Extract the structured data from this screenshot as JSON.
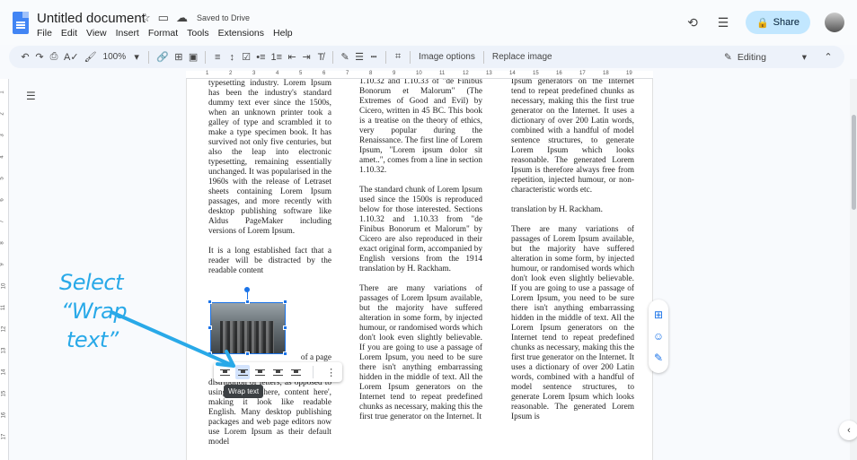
{
  "doc": {
    "title": "Untitled document",
    "saved_status": "Saved to Drive",
    "share_label": "Share"
  },
  "menu": [
    "File",
    "Edit",
    "View",
    "Insert",
    "Format",
    "Tools",
    "Extensions",
    "Help"
  ],
  "toolbar": {
    "zoom": "100%",
    "image_options_label": "Image options",
    "replace_image_label": "Replace image",
    "mode": "Editing"
  },
  "ruler_top_numbers": [
    "1",
    "2",
    "3",
    "4",
    "5",
    "6",
    "7",
    "8",
    "9",
    "10",
    "11",
    "12",
    "13",
    "14",
    "15",
    "16",
    "17",
    "18",
    "19"
  ],
  "ruler_left_numbers": [
    "1",
    "2",
    "3",
    "4",
    "5",
    "6",
    "7",
    "8",
    "9",
    "10",
    "11",
    "12",
    "13",
    "14",
    "15",
    "16",
    "17"
  ],
  "columns": {
    "c1": [
      "typesetting industry. Lorem Ipsum has been the industry's standard dummy text ever since the 1500s, when an unknown printer took a galley of type and scrambled it to make a type specimen book. It has survived not only five centuries, but also the leap into electronic typesetting, remaining essentially unchanged. It was popularised in the 1960s with the release of Letraset sheets containing Lorem Ipsum passages, and more recently with desktop publishing software like Aldus PageMaker including versions of Lorem Ipsum.",
      "It is a long established fact that a reader will be distracted by the readable content",
      "of a page",
      "distribution of letters, as opposed to using 'Content here, content here', making it look like readable English. Many desktop publishing packages and web page editors now use Lorem Ipsum as their default model"
    ],
    "c2": [
      "1.10.32 and 1.10.33 of \"de Finibus Bonorum et Malorum\" (The Extremes of Good and Evil) by Cicero, written in 45 BC. This book is a treatise on the theory of ethics, very popular during the Renaissance. The first line of Lorem Ipsum, \"Lorem ipsum dolor sit amet..\", comes from a line in section 1.10.32.",
      "The standard chunk of Lorem Ipsum used since the 1500s is reproduced below for those interested. Sections 1.10.32 and 1.10.33 from \"de Finibus Bonorum et Malorum\" by Cicero are also reproduced in their exact original form, accompanied by English versions from the 1914 translation by H. Rackham.",
      "There are many variations of passages of Lorem Ipsum available, but the majority have suffered alteration in some form, by injected humour, or randomised words which don't look even slightly believable. If you are going to use a passage of Lorem Ipsum, you need to be sure there isn't anything embarrassing hidden in the middle of text. All the Lorem Ipsum generators on the Internet tend to repeat predefined chunks as necessary, making this the first true generator on the Internet. It"
    ],
    "c3": [
      "Ipsum generators on the Internet tend to repeat predefined chunks as necessary, making this the first true generator on the Internet. It uses a dictionary of over 200 Latin words, combined with a handful of model sentence structures, to generate Lorem Ipsum which looks reasonable. The generated Lorem Ipsum is therefore always free from repetition, injected humour, or non-characteristic words etc.",
      "translation by H. Rackham.",
      "There are many variations of passages of Lorem Ipsum available, but the majority have suffered alteration in some form, by injected humour, or randomised words which don't look even slightly believable. If you are going to use a passage of Lorem Ipsum, you need to be sure there isn't anything embarrassing hidden in the middle of text. All the Lorem Ipsum generators on the Internet tend to repeat predefined chunks as necessary, making this the first true generator on the Internet. It uses a dictionary of over 200 Latin words, combined with a handful of model sentence structures, to generate Lorem Ipsum which looks reasonable. The generated Lorem Ipsum is"
    ]
  },
  "wrap_tooltip": "Wrap text",
  "annotation": {
    "line1": "Select",
    "line2": "“Wrap",
    "line3": "text”",
    "color": "#29a9e8"
  },
  "colors": {
    "accent": "#1a73e8",
    "share_bg": "#c2e7ff",
    "toolbar_bg": "#edf2fa"
  }
}
